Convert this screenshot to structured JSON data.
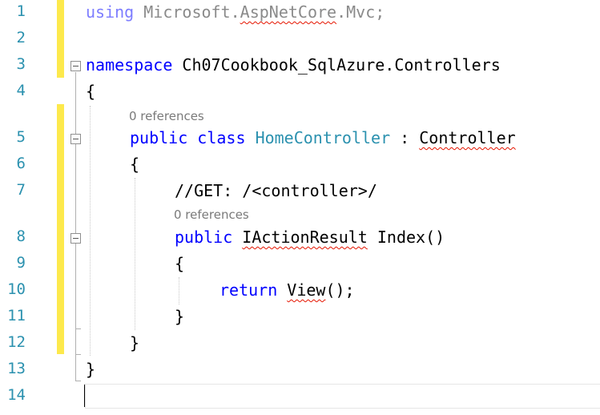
{
  "editor": {
    "line_numbers": [
      "1",
      "2",
      "3",
      "4",
      "5",
      "6",
      "7",
      "8",
      "9",
      "10",
      "11",
      "12",
      "13",
      "14"
    ],
    "codelens": {
      "class_refs": "0 references",
      "method_refs": "0 references"
    },
    "lines": {
      "l1_using": "using",
      "l1_ns_a": " Microsoft.",
      "l1_ns_b": "AspNetCore",
      "l1_ns_c": ".Mvc;",
      "l3_kw": "namespace",
      "l3_name": " Ch07Cookbook_SqlAzure.Controllers",
      "l4": "{",
      "l5_kw1": "public",
      "l5_kw2": "class",
      "l5_type": "HomeController",
      "l5_colon": " : ",
      "l5_base": "Controller",
      "l6": "{",
      "l7": "//GET: /<controller>/",
      "l8_kw": "public",
      "l8_type": "IActionResult",
      "l8_rest": " Index()",
      "l9": "{",
      "l10_kw": "return",
      "l10_call": "View",
      "l10_rest": "();",
      "l11": "}",
      "l12": "}",
      "l13": "}"
    }
  }
}
